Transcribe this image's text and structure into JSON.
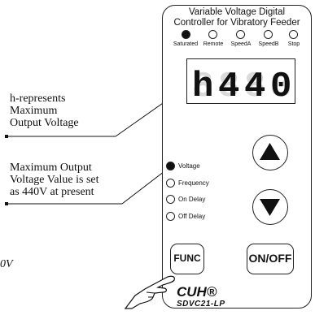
{
  "annotations": {
    "first": [
      "h-represents",
      "Maximum",
      "Output Voltage"
    ],
    "second": [
      "Maximum Output",
      "Voltage Value is set",
      "as 440V at present"
    ],
    "partial_left": "0V"
  },
  "panel": {
    "title_line1": "Variable Voltage Digital",
    "title_line2": "Controller for Vibratory Feeder",
    "leds": [
      {
        "label": "Saturated",
        "on": true
      },
      {
        "label": "Remote",
        "on": false
      },
      {
        "label": "SpeedA",
        "on": false
      },
      {
        "label": "SpeedB",
        "on": false
      },
      {
        "label": "Stop",
        "on": false
      }
    ],
    "display": "h440",
    "indicators": [
      {
        "label": "Voltage",
        "on": true
      },
      {
        "label": "Frequency",
        "on": false
      },
      {
        "label": "On Delay",
        "on": false
      },
      {
        "label": "Off Delay",
        "on": false
      }
    ],
    "up_icon": "triangle-up-icon",
    "down_icon": "triangle-down-icon",
    "func_label": "FUNC",
    "onoff_label": "ON/OFF",
    "brand": "CUH®",
    "model": "SDVC21-LP"
  }
}
